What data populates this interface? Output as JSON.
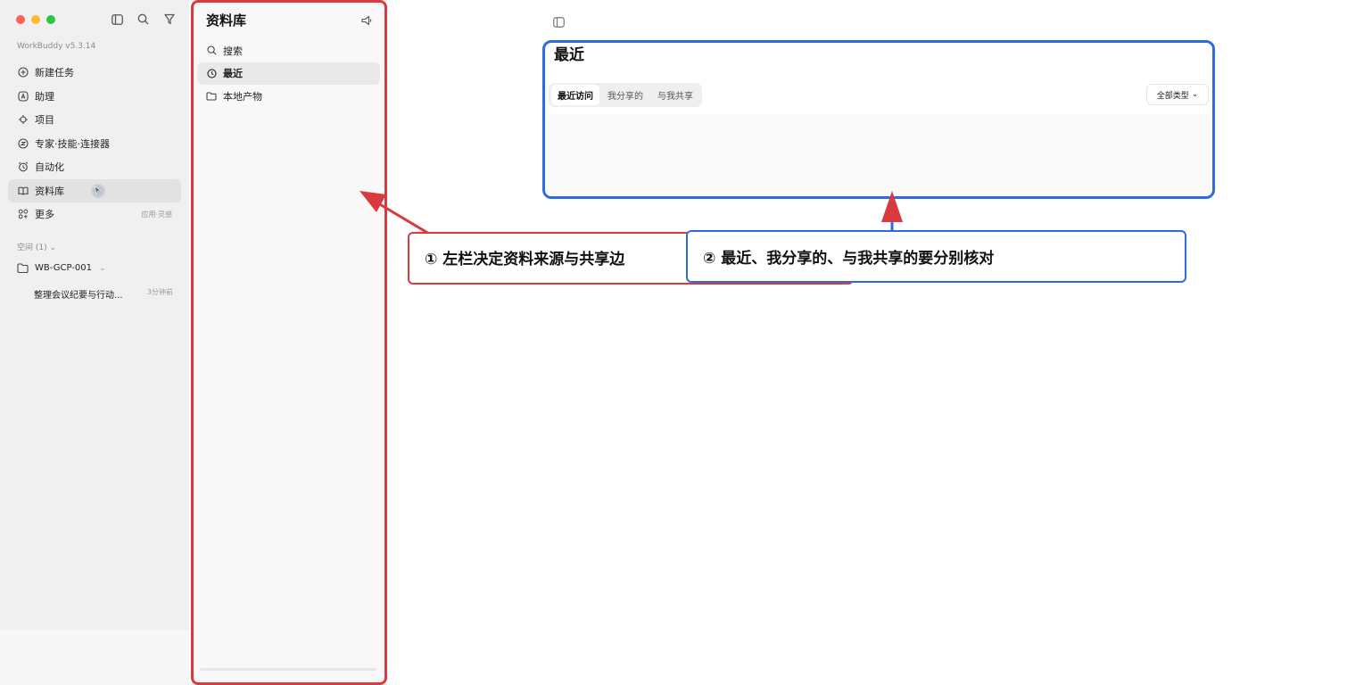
{
  "app": {
    "name": "WorkBuddy",
    "version": "v5.3.14"
  },
  "sidebar": {
    "items": [
      {
        "label": "新建任务",
        "icon": "plus-circle-icon"
      },
      {
        "label": "助理",
        "icon": "assistant-icon"
      },
      {
        "label": "项目",
        "icon": "project-icon"
      },
      {
        "label": "专家·技能·连接器",
        "icon": "expert-icon"
      },
      {
        "label": "自动化",
        "icon": "alarm-icon"
      },
      {
        "label": "资料库",
        "icon": "book-icon",
        "active": true
      },
      {
        "label": "更多",
        "icon": "grid-icon",
        "extra": "应用·灵感"
      }
    ],
    "space_label": "空间 (1)",
    "workspace": "WB-GCP-001",
    "task": {
      "title": "整理会议纪要与行动...",
      "time": "3分钟前"
    }
  },
  "library": {
    "title": "资料库",
    "items": [
      {
        "label": "搜索",
        "icon": "search-icon"
      },
      {
        "label": "最近",
        "icon": "clock-icon",
        "active": true
      },
      {
        "label": "本地产物",
        "icon": "folder-icon"
      }
    ]
  },
  "main": {
    "title": "最近",
    "tabs": [
      {
        "label": "最近访问",
        "active": true
      },
      {
        "label": "我分享的"
      },
      {
        "label": "与我共享"
      }
    ],
    "filter": "全部类型"
  },
  "annotations": {
    "red": "① 左栏决定资料来源与共享边",
    "blue": "② 最近、我分享的、与我共享的要分别核对"
  },
  "colors": {
    "annotation_red": "#d83a3f",
    "annotation_blue": "#2e6be0",
    "sidebar_bg": "#f0f0f0"
  }
}
